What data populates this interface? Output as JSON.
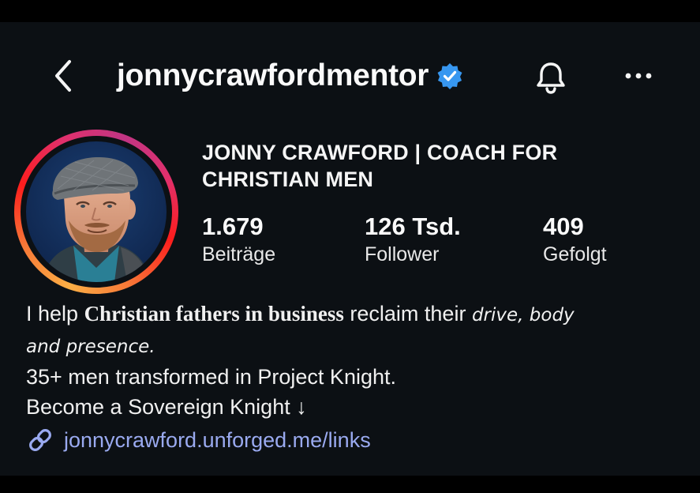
{
  "header": {
    "username": "jonnycrawfordmentor",
    "icons": {
      "back": "chevron-left-icon",
      "verified": "verified-badge-icon",
      "notifications": "bell-icon",
      "more": "more-horizontal-icon"
    }
  },
  "profile": {
    "display_name": "JONNY CRAWFORD | COACH FOR CHRISTIAN MEN",
    "stats": [
      {
        "value": "1.679",
        "label": "Beiträge"
      },
      {
        "value": "126 Tsd.",
        "label": "Follower"
      },
      {
        "value": "409",
        "label": "Gefolgt"
      }
    ]
  },
  "bio": {
    "line1_prefix": "I help ",
    "line1_bold": "Christian fathers in business",
    "line1_mid": " reclaim their ",
    "line1_ital1": "drive",
    "line1_comma": ", ",
    "line1_ital2": "body",
    "line2_ital": "and presence",
    "line2_end": ".",
    "line3": "35+ men transformed in Project Knight.",
    "line4": "Become a Sovereign Knight ↓"
  },
  "link": {
    "text": "jonnycrawford.unforged.me/links",
    "icon": "link-icon"
  },
  "colors": {
    "background": "#0c1014",
    "verified_blue": "#3797f0",
    "link": "#9aaaf0"
  }
}
